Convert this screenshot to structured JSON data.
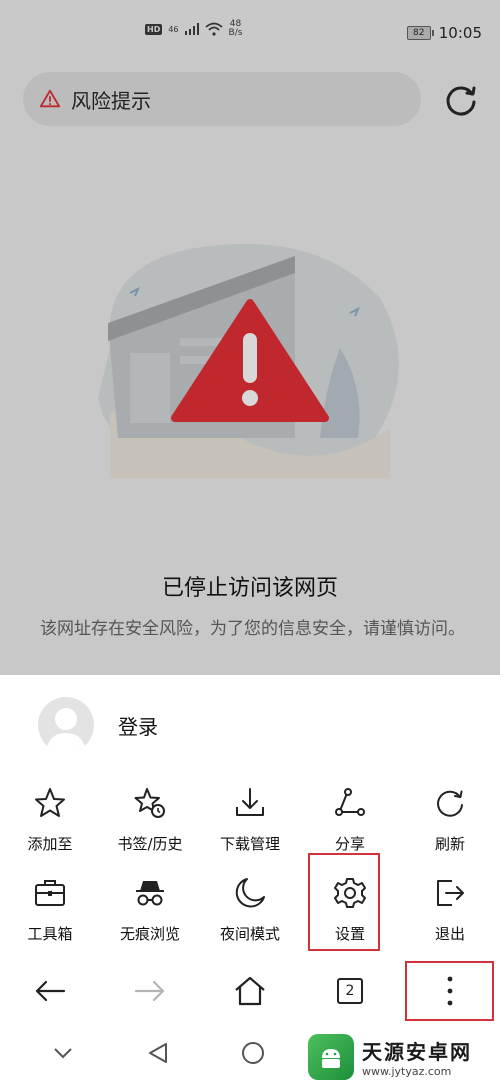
{
  "status_bar": {
    "hd": "HD",
    "signal": "46",
    "net_speed_value": "48",
    "net_speed_unit": "B/s",
    "battery": "82",
    "time": "10:05"
  },
  "address_bar": {
    "title": "风险提示"
  },
  "blocked": {
    "title": "已停止访问该网页",
    "description": "该网址存在安全风险，为了您的信息安全，请谨慎访问。"
  },
  "menu": {
    "login_label": "登录",
    "items": [
      {
        "label": "添加至",
        "icon": "star-icon"
      },
      {
        "label": "书签/历史",
        "icon": "bookmark-history-icon"
      },
      {
        "label": "下载管理",
        "icon": "download-icon"
      },
      {
        "label": "分享",
        "icon": "share-icon"
      },
      {
        "label": "刷新",
        "icon": "refresh-icon"
      },
      {
        "label": "工具箱",
        "icon": "toolbox-icon"
      },
      {
        "label": "无痕浏览",
        "icon": "incognito-icon"
      },
      {
        "label": "夜间模式",
        "icon": "moon-icon"
      },
      {
        "label": "设置",
        "icon": "gear-icon"
      },
      {
        "label": "退出",
        "icon": "exit-icon"
      }
    ]
  },
  "bottom_nav": {
    "tab_count": "2"
  },
  "watermark": {
    "title": "天源安卓网",
    "url": "www.jytyaz.com"
  },
  "colors": {
    "highlight": "#d2323a",
    "warning": "#c0282e",
    "background_dim": "#c8c8c8"
  }
}
